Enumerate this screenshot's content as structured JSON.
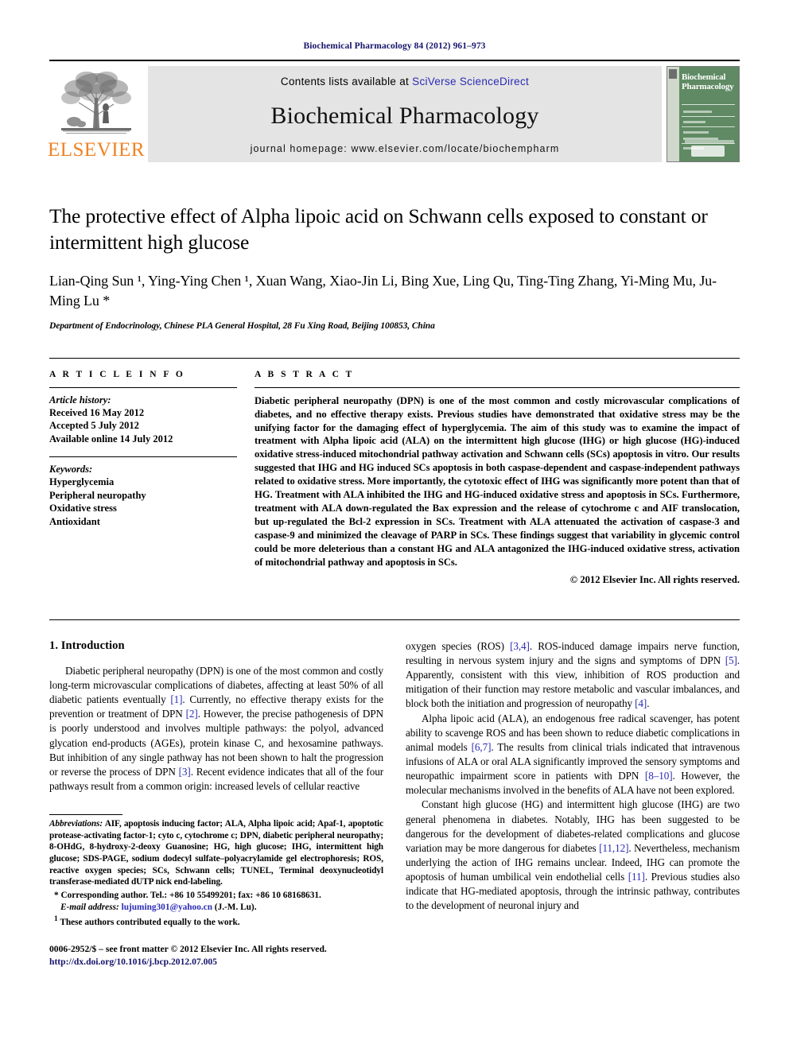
{
  "running_head": "Biochemical Pharmacology 84 (2012) 961–973",
  "masthead": {
    "publisher_name": "ELSEVIER",
    "contents_prefix": "Contents lists available at ",
    "contents_link": "SciVerse ScienceDirect",
    "journal_title": "Biochemical Pharmacology",
    "homepage_label": "journal homepage: www.elsevier.com/locate/biochempharm",
    "cover_title_line1": "Biochemical",
    "cover_title_line2": "Pharmacology"
  },
  "article": {
    "title": "The protective effect of Alpha lipoic acid on Schwann cells exposed to constant or intermittent high glucose",
    "authors": "Lian-Qing Sun ¹, Ying-Ying Chen ¹, Xuan Wang, Xiao-Jin Li, Bing Xue, Ling Qu, Ting-Ting Zhang, Yi-Ming Mu, Ju-Ming Lu *",
    "affiliation": "Department of Endocrinology, Chinese PLA General Hospital, 28 Fu Xing Road, Beijing 100853, China"
  },
  "article_info": {
    "heading": "A R T I C L E   I N F O",
    "history_label": "Article history:",
    "history": [
      "Received 16 May 2012",
      "Accepted 5 July 2012",
      "Available online 14 July 2012"
    ],
    "keywords_label": "Keywords:",
    "keywords": [
      "Hyperglycemia",
      "Peripheral neuropathy",
      "Oxidative stress",
      "Antioxidant"
    ]
  },
  "abstract": {
    "heading": "A B S T R A C T",
    "body": "Diabetic peripheral neuropathy (DPN) is one of the most common and costly microvascular complications of diabetes, and no effective therapy exists. Previous studies have demonstrated that oxidative stress may be the unifying factor for the damaging effect of hyperglycemia. The aim of this study was to examine the impact of treatment with Alpha lipoic acid (ALA) on the intermittent high glucose (IHG) or high glucose (HG)-induced oxidative stress-induced mitochondrial pathway activation and Schwann cells (SCs) apoptosis in vitro. Our results suggested that IHG and HG induced SCs apoptosis in both caspase-dependent and caspase-independent pathways related to oxidative stress. More importantly, the cytotoxic effect of IHG was significantly more potent than that of HG. Treatment with ALA inhibited the IHG and HG-induced oxidative stress and apoptosis in SCs. Furthermore, treatment with ALA down-regulated the Bax expression and the release of cytochrome c and AIF translocation, but up-regulated the Bcl-2 expression in SCs. Treatment with ALA attenuated the activation of caspase-3 and caspase-9 and minimized the cleavage of PARP in SCs. These findings suggest that variability in glycemic control could be more deleterious than a constant HG and ALA antagonized the IHG-induced oxidative stress, activation of mitochondrial pathway and apoptosis in SCs.",
    "copyright": "© 2012 Elsevier Inc. All rights reserved."
  },
  "intro": {
    "heading": "1. Introduction",
    "left_p1_a": "Diabetic peripheral neuropathy (DPN) is one of the most common and costly long-term microvascular complications of diabetes, affecting at least 50% of all diabetic patients eventually ",
    "left_p1_r1": "[1]",
    "left_p1_b": ". Currently, no effective therapy exists for the prevention or treatment of DPN ",
    "left_p1_r2": "[2]",
    "left_p1_c": ". However, the precise pathogenesis of DPN is poorly understood and involves multiple pathways: the polyol, advanced glycation end-products (AGEs), protein kinase C, and hexosamine pathways. But inhibition of any single pathway has not been shown to halt the progression or reverse the process of DPN ",
    "left_p1_r3": "[3]",
    "left_p1_d": ". Recent evidence indicates that all of the four pathways result from a common origin: increased levels of cellular reactive",
    "right_p1_a": "oxygen species (ROS) ",
    "right_p1_r1": "[3,4]",
    "right_p1_b": ". ROS-induced damage impairs nerve function, resulting in nervous system injury and the signs and symptoms of DPN ",
    "right_p1_r2": "[5]",
    "right_p1_c": ". Apparently, consistent with this view, inhibition of ROS production and mitigation of their function may restore metabolic and vascular imbalances, and block both the initiation and progression of neuropathy ",
    "right_p1_r3": "[4]",
    "right_p1_d": ".",
    "right_p2_a": "Alpha lipoic acid (ALA), an endogenous free radical scavenger, has potent ability to scavenge ROS and has been shown to reduce diabetic complications in animal models ",
    "right_p2_r1": "[6,7]",
    "right_p2_b": ". The results from clinical trials indicated that intravenous infusions of ALA or oral ALA significantly improved the sensory symptoms and neuropathic impairment score in patients with DPN ",
    "right_p2_r2": "[8–10]",
    "right_p2_c": ". However, the molecular mechanisms involved in the benefits of ALA have not been explored.",
    "right_p3_a": "Constant high glucose (HG) and intermittent high glucose (IHG) are two general phenomena in diabetes. Notably, IHG has been suggested to be dangerous for the development of diabetes-related complications and glucose variation may be more dangerous for diabetes ",
    "right_p3_r1": "[11,12]",
    "right_p3_b": ". Nevertheless, mechanism underlying the action of IHG remains unclear. Indeed, IHG can promote the apoptosis of human umbilical vein endothelial cells ",
    "right_p3_r2": "[11]",
    "right_p3_c": ". Previous studies also indicate that HG-mediated apoptosis, through the intrinsic pathway, contributes to the development of neuronal injury and"
  },
  "footnotes": {
    "abbreviations_label": "Abbreviations:",
    "abbreviations_text": " AIF, apoptosis inducing factor; ALA, Alpha lipoic acid; Apaf-1, apoptotic protease-activating factor-1; cyto c, cytochrome c; DPN, diabetic peripheral neuropathy; 8-OHdG, 8-hydroxy-2-deoxy Guanosine; HG, high glucose; IHG, intermittent high glucose; SDS-PAGE, sodium dodecyl sulfate–polyacrylamide gel electrophoresis; ROS, reactive oxygen species; SCs, Schwann cells; TUNEL, Terminal deoxynucleotidyl transferase-mediated dUTP nick end-labeling.",
    "corresponding_marker": "*",
    "corresponding_text": "Corresponding author. Tel.: +86 10 55499201; fax: +86 10 68168631.",
    "email_label": "E-mail address:",
    "email_value": "lujuming301@yahoo.cn",
    "email_suffix": " (J.-M. Lu).",
    "equal_marker": "1",
    "equal_text": "These authors contributed equally to the work."
  },
  "imprint": {
    "issn_line": "0006-2952/$ – see front matter © 2012 Elsevier Inc. All rights reserved.",
    "doi_line": "http://dx.doi.org/10.1016/j.bcp.2012.07.005"
  }
}
